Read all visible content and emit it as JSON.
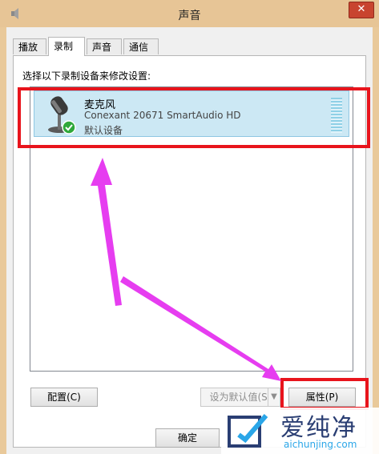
{
  "window": {
    "title": "声音",
    "close_symbol": "✕"
  },
  "tabs": [
    {
      "label": "播放",
      "active": false
    },
    {
      "label": "录制",
      "active": true
    },
    {
      "label": "声音",
      "active": false
    },
    {
      "label": "通信",
      "active": false
    }
  ],
  "instruction": "选择以下录制设备来修改设置:",
  "device": {
    "name": "麦克风",
    "description": "Conexant 20671 SmartAudio HD",
    "status": "默认设备",
    "icon": "microphone-icon",
    "status_icon": "check-badge-icon"
  },
  "buttons": {
    "configure": "配置(C)",
    "set_default": "设为默认值(S)",
    "properties": "属性(P)",
    "ok": "确定"
  },
  "annotations": {
    "highlight_color": "#e8141c",
    "arrow_color": "#e63df0"
  },
  "watermark": {
    "title": "爱纯净",
    "url": "aichunjing.com"
  }
}
